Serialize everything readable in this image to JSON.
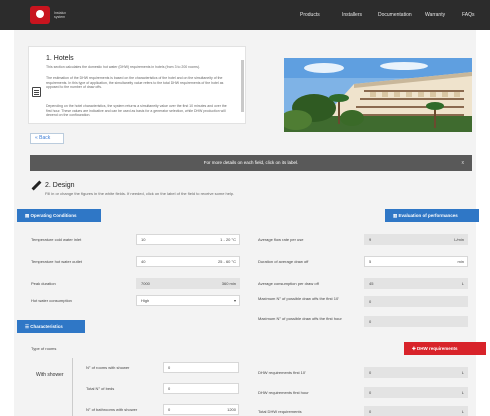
{
  "header": {
    "logo_text": "Instalux system",
    "nav": [
      "Products",
      "Installers",
      "Documentation",
      "Warranty",
      "FAQs"
    ]
  },
  "hotels": {
    "title": "1. Hotels",
    "p1": "This section calculates the domestic hot water (DHW) requirements in hotels (from 3 to 200 rooms).",
    "p2": "The estimation of the DHW requirements is based on the characteristics of the hotel and on the simultaneity of the requirements. In this type of application, the simultaneity value refers to the total DHW requirements of the hotel as opposed to the number of draw offs.",
    "p3": "Depending on the hotel characteristics, the system returns a simultaneity value over the first 10 minutes and over the first hour. These values are indicative and can be used as basis for a generator selection, while DHW production will depend on the configuration."
  },
  "back_label": "« Back",
  "infobar": {
    "text": "For more details on each field, click on its label.",
    "close": "x"
  },
  "design": {
    "title": "2. Design",
    "subtitle": "Fill in or change the figures in the white fields. If needed, click on the label of the field to receive some help."
  },
  "tabs": {
    "operating": "Operating Conditions",
    "evaluation": "Evaluation of performances",
    "characteristics": "Characteristics",
    "dhw": "DHW requirements"
  },
  "operating": [
    {
      "label": "Temperature cold water inlet",
      "value": "10",
      "unit": "1 - 20 °C"
    },
    {
      "label": "Temperature hot water outlet",
      "value": "40",
      "unit": "25 - 60 °C"
    },
    {
      "label": "Peak duration",
      "value": "7000",
      "unit": "360 min"
    },
    {
      "label": "Hot water consumption",
      "value": "High",
      "unit": "▾"
    }
  ],
  "evaluation": [
    {
      "label": "Average flow rate per use",
      "value": "9",
      "unit": "L/min"
    },
    {
      "label": "Duration of average draw off",
      "value": "5",
      "unit": "min"
    },
    {
      "label": "Average consumption per draw off",
      "value": "45",
      "unit": "L"
    },
    {
      "label": "Maximum N° of possible draw offs the first 10'",
      "value": "0",
      "unit": ""
    },
    {
      "label": "Maximum N° of possible draw offs the first hour",
      "value": "0",
      "unit": ""
    }
  ],
  "rooms": {
    "type_label": "Type of rooms",
    "with_shower": "With shower",
    "fields": [
      {
        "label": "N° of rooms with shower",
        "value": "0",
        "unit": ""
      },
      {
        "label": "Total N° of beds",
        "value": "0",
        "unit": ""
      },
      {
        "label": "N° of bathrooms with shower",
        "value": "0",
        "unit": "1200"
      }
    ]
  },
  "dhw": [
    {
      "label": "DHW requirements first 10'",
      "value": "0",
      "unit": "L"
    },
    {
      "label": "DHW requirements first hour",
      "value": "0",
      "unit": "L"
    },
    {
      "label": "Total DHW requirements",
      "value": "0",
      "unit": "L"
    }
  ],
  "colors": {
    "blue": "#2f77c6",
    "red": "#d8232a",
    "dark": "#2c2c2c"
  }
}
